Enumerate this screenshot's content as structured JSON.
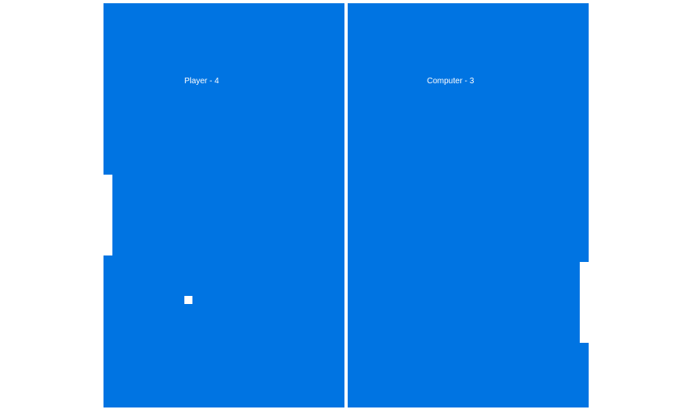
{
  "scoreboard": {
    "player_label": "Player - 4",
    "computer_label": "Computer - 3"
  },
  "colors": {
    "court": "#0074e2",
    "foreground": "#ffffff"
  },
  "game_state": {
    "player_score": 4,
    "computer_score": 3
  }
}
